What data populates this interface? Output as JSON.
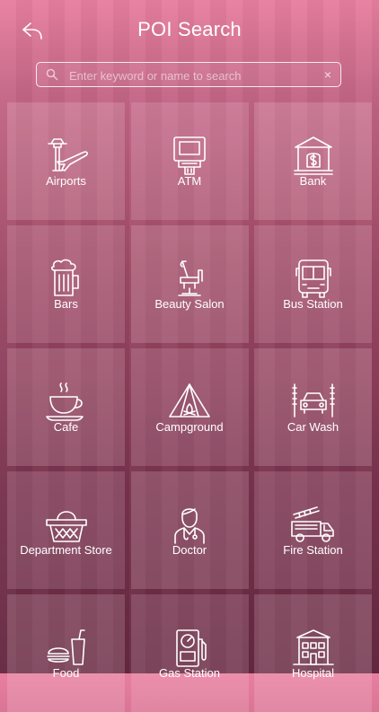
{
  "header": {
    "title": "POI Search"
  },
  "search": {
    "placeholder": "Enter keyword or name to search",
    "value": "",
    "clear_glyph": "×"
  },
  "tiles": [
    {
      "label": "Airports",
      "icon": "airport-icon"
    },
    {
      "label": "ATM",
      "icon": "atm-icon"
    },
    {
      "label": "Bank",
      "icon": "bank-icon"
    },
    {
      "label": "Bars",
      "icon": "beer-mug-icon"
    },
    {
      "label": "Beauty Salon",
      "icon": "salon-chair-icon"
    },
    {
      "label": "Bus Station",
      "icon": "bus-icon"
    },
    {
      "label": "Cafe",
      "icon": "coffee-cup-icon"
    },
    {
      "label": "Campground",
      "icon": "tent-icon"
    },
    {
      "label": "Car Wash",
      "icon": "car-wash-icon"
    },
    {
      "label": "Department Store",
      "icon": "basket-icon"
    },
    {
      "label": "Doctor",
      "icon": "doctor-icon"
    },
    {
      "label": "Fire Station",
      "icon": "fire-truck-icon"
    },
    {
      "label": "Food",
      "icon": "fast-food-icon"
    },
    {
      "label": "Gas Station",
      "icon": "gas-pump-icon"
    },
    {
      "label": "Hospital",
      "icon": "hospital-icon"
    }
  ],
  "colors": {
    "gradient_top": "#e87fa0",
    "gradient_bottom": "#6d2b46",
    "text": "#ffffff"
  }
}
